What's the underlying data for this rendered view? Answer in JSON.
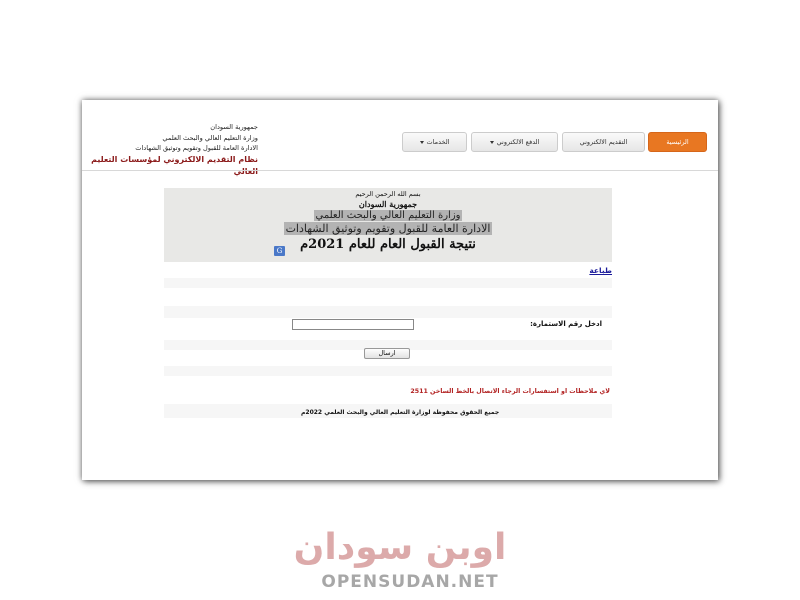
{
  "header": {
    "line1": "جمهورية السودان",
    "line2": "وزارة التعليم العالي والبحث العلمي",
    "line3": "الادارة العامة للقبول وتقويم وتوثيق الشهادات",
    "system_name": "نظام التقديم الالكتروني لمؤسسات التعليم العالي"
  },
  "nav": {
    "home": "الرئيسية",
    "e_apply": "التقديم الالكتروني",
    "e_pay": "الدفع الالكتروني",
    "services": "الخدمات"
  },
  "banner": {
    "basmala": "بسم الله الرحمن الرحيم",
    "republic": "جمهورية السودان",
    "ministry": "وزارة التعليم العالي والبحث العلمي",
    "admin": "الادارة العامة للقبول وتقويم وتوثيق الشهادات",
    "result_title": "نتيجة القبول العام  للعام 2021م"
  },
  "print_link": "طباعة",
  "form": {
    "label": "ادخل  رقم الاستمارة:",
    "value": "",
    "submit": "ارسال"
  },
  "contact_note": "لاي ملاحظات او استفسارات الرجاء الاتصال بالخط الساخن 2511",
  "copyright": "جميع الحقوق محفوظة لوزارة التعليم العالي والبحث العلمي 2022م",
  "watermark": {
    "arabic": "اوبن سودان",
    "latin": "OPENSUDAN.NET"
  },
  "colors": {
    "home_button": "#e87722",
    "system_name": "#8b1a1a",
    "contact_note": "#b22222",
    "banner_bg": "#e8e8e6"
  }
}
